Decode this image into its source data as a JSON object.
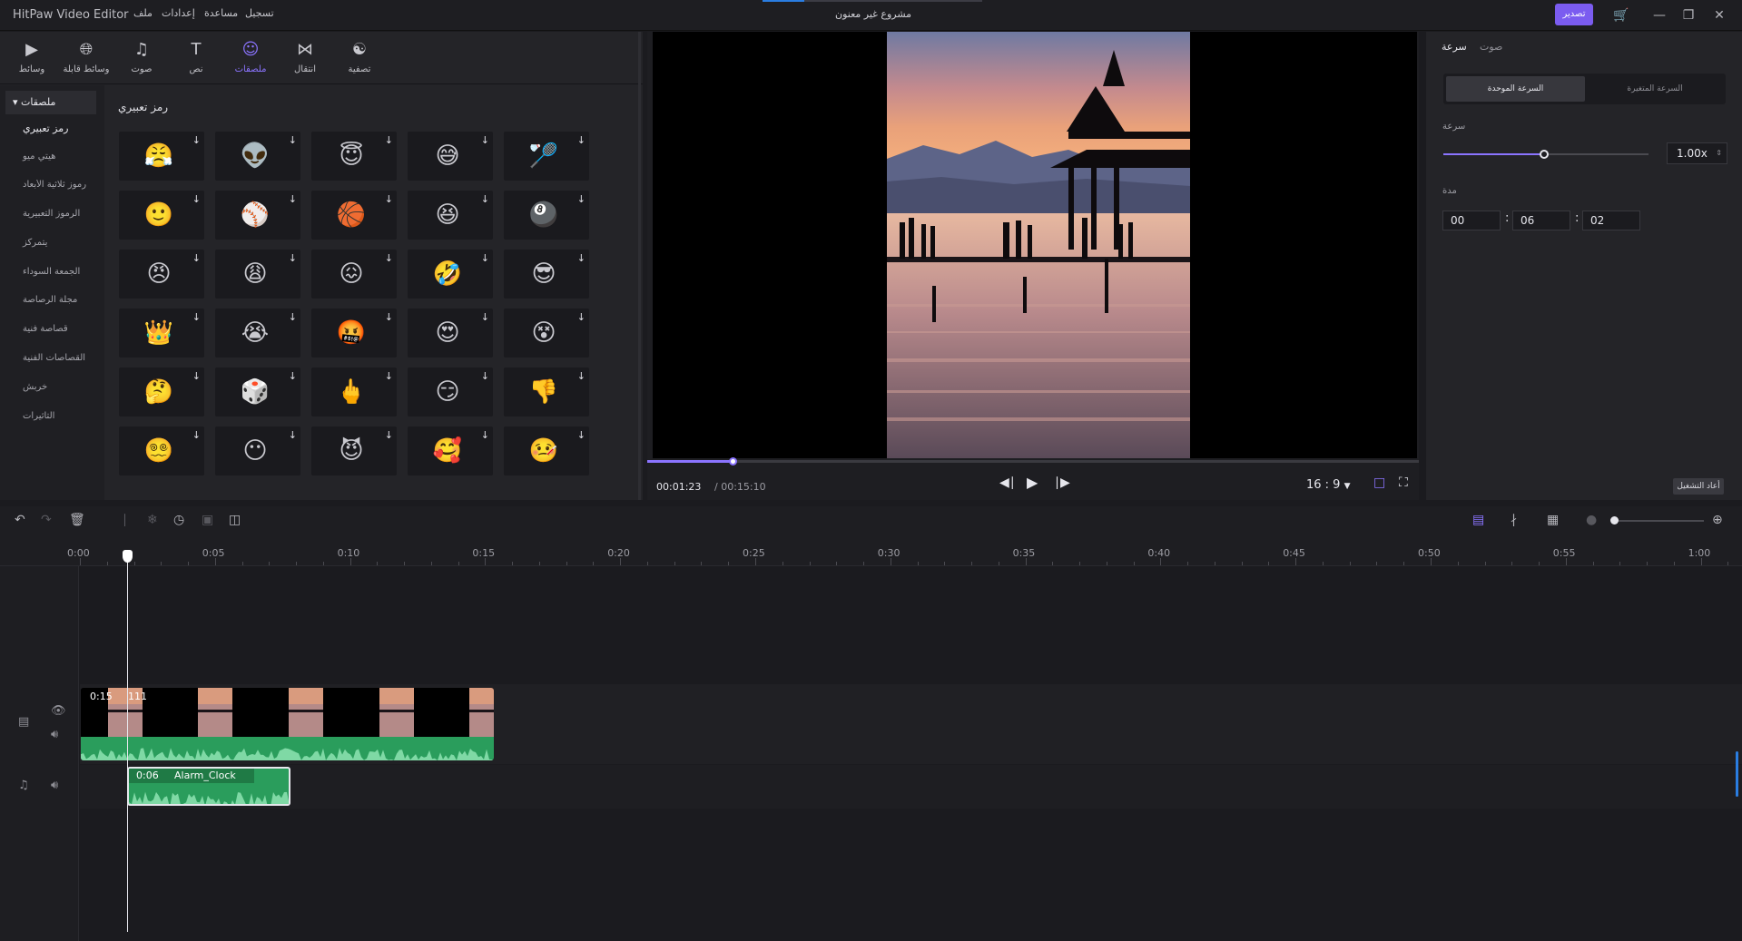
{
  "titlebar": {
    "app_name": "HitPaw Video Editor",
    "menu": [
      "ملف",
      "إعدادات",
      "مساعدة",
      "تسجيل"
    ],
    "project_title": "مشروع غير معنون",
    "export_label": "تصدير",
    "icons": [
      "cart-icon",
      "minimize-icon",
      "restore-icon",
      "close-icon"
    ]
  },
  "toolbar": {
    "items": [
      {
        "label": "وسائط",
        "icon": "media-icon"
      },
      {
        "label": "وسائط قابلة",
        "icon": "stock-media-icon"
      },
      {
        "label": "صوت",
        "icon": "music-icon"
      },
      {
        "label": "نص",
        "icon": "text-icon"
      },
      {
        "label": "ملصقات",
        "icon": "sticker-icon",
        "active": true
      },
      {
        "label": "انتقال",
        "icon": "transition-icon"
      },
      {
        "label": "تصفية",
        "icon": "filter-icon"
      }
    ]
  },
  "categories": {
    "header": "ملصقات",
    "items": [
      "رمز تعبيري",
      "هيتي ميو",
      "رموز ثلاثية الأبعاد",
      "الرموز التعبيرية",
      "يتمركز",
      "الجمعة السوداء",
      "مجلة الرصاصة",
      "قصاصة فنية",
      "القصاصات الفنية",
      "خربش",
      "التأثيرات"
    ]
  },
  "grid": {
    "title": "رمز تعبيري",
    "stickers": [
      [
        "😤",
        "👽",
        "😇",
        "😅",
        "🏸"
      ],
      [
        "🙂",
        "⚾",
        "🏀",
        "😆",
        "🎱"
      ],
      [
        "😠",
        "😩",
        "😖",
        "🤣",
        "😎"
      ],
      [
        "👑",
        "😭",
        "🤬",
        "😍",
        "😵"
      ],
      [
        "🤔",
        "🎲",
        "🖕",
        "😏",
        "👎"
      ],
      [
        "😵‍💫",
        "😶",
        "😈",
        "🥰",
        "🤒"
      ]
    ]
  },
  "preview": {
    "time_current": "00:01:23",
    "time_total": "/ 00:15:10",
    "aspect": "16 : 9",
    "progress": 0.11
  },
  "props": {
    "tab_speed": "سرعة",
    "tab_audio": "صوت",
    "seg_uniform": "السرعة الموحدة",
    "seg_variable": "السرعة المتغيرة",
    "speed_label": "سرعة",
    "speed_value": "1.00x",
    "speed_fraction": 0.49,
    "duration_label": "مدة",
    "duration": [
      "00",
      "06",
      "02"
    ],
    "sep": ":",
    "reset_label": "أعاد التشغيل"
  },
  "timeline": {
    "ticks": [
      "0:00",
      "0:05",
      "0:10",
      "0:15",
      "0:20",
      "0:25",
      "0:30",
      "0:35",
      "0:40",
      "0:45",
      "0:50",
      "0:55",
      "1:00"
    ],
    "video_clip_label": "0:15",
    "video_clip_label2": "111",
    "audio_clip_duration": "0:06",
    "audio_clip_name": "Alarm_Clock"
  }
}
